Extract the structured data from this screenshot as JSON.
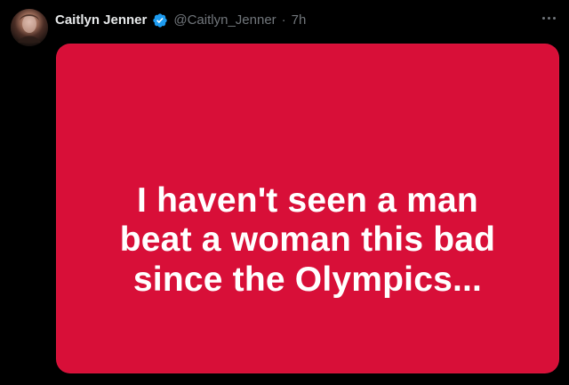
{
  "tweet": {
    "author": {
      "display_name": "Caitlyn Jenner",
      "handle": "@Caitlyn_Jenner",
      "time": "7h"
    },
    "separator": "·",
    "icons": {
      "avatar": "avatar",
      "verified": "verified-badge-icon",
      "more": "more-icon"
    },
    "media": {
      "lines": [
        "I haven't seen a man",
        "beat a woman this bad",
        "since the Olympics..."
      ]
    }
  },
  "colors": {
    "background": "#000000",
    "text_primary": "#e7e9ea",
    "text_secondary": "#71767b",
    "verified": "#1d9bf0",
    "media_background": "#d80f38",
    "media_text": "#ffffff"
  }
}
